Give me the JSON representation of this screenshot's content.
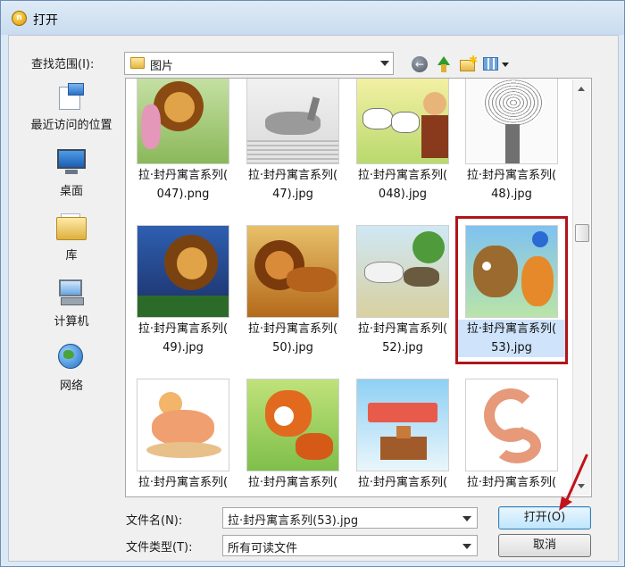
{
  "window": {
    "title": "打开",
    "app_icon_text": "n"
  },
  "toolbar": {
    "look_in_label": "查找范围(I):",
    "look_in_value": "图片",
    "back_glyph": "←",
    "newfolder_glyph": "✱"
  },
  "places": [
    {
      "label": "最近访问的位置",
      "icon": "recent-places-icon"
    },
    {
      "label": "桌面",
      "icon": "desktop-icon"
    },
    {
      "label": "库",
      "icon": "libraries-icon"
    },
    {
      "label": "计算机",
      "icon": "computer-icon"
    },
    {
      "label": "网络",
      "icon": "network-icon"
    }
  ],
  "files": [
    {
      "line1": "拉·封丹寓言系列(",
      "line2": "047).png",
      "art": "lion-pink",
      "selected": false
    },
    {
      "line1": "拉·封丹寓言系列(",
      "line2": "47).jpg",
      "art": "deer-sketch",
      "selected": false
    },
    {
      "line1": "拉·封丹寓言系列(",
      "line2": "048).jpg",
      "art": "goats",
      "selected": false
    },
    {
      "line1": "拉·封丹寓言系列(",
      "line2": "48).jpg",
      "art": "tree-sketch",
      "selected": false
    },
    {
      "line1": "拉·封丹寓言系列(",
      "line2": "49).jpg",
      "art": "lion-blue",
      "selected": false
    },
    {
      "line1": "拉·封丹寓言系列(",
      "line2": "50).jpg",
      "art": "lion-orange",
      "selected": false
    },
    {
      "line1": "拉·封丹寓言系列(",
      "line2": "52).jpg",
      "art": "horse-donkey",
      "selected": false
    },
    {
      "line1": "拉·封丹寓言系列(",
      "line2": "53).jpg",
      "art": "bear-fox",
      "selected": true
    },
    {
      "line1": "拉·封丹寓言系列(",
      "line2": "",
      "art": "hen",
      "selected": false
    },
    {
      "line1": "拉·封丹寓言系列(",
      "line2": "",
      "art": "fox-chick",
      "selected": false
    },
    {
      "line1": "拉·封丹寓言系列(",
      "line2": "",
      "art": "eagle-chicken",
      "selected": false
    },
    {
      "line1": "拉·封丹寓言系列(",
      "line2": "",
      "art": "snake",
      "selected": false
    }
  ],
  "footer": {
    "filename_label": "文件名(N):",
    "filename_value": "拉·封丹寓言系列(53).jpg",
    "filetype_label": "文件类型(T):",
    "filetype_value": "所有可读文件",
    "open_label": "打开(O)",
    "cancel_label": "取消"
  },
  "colors": {
    "selection_frame": "#b0141a",
    "annotation_arrow": "#c0141a"
  }
}
